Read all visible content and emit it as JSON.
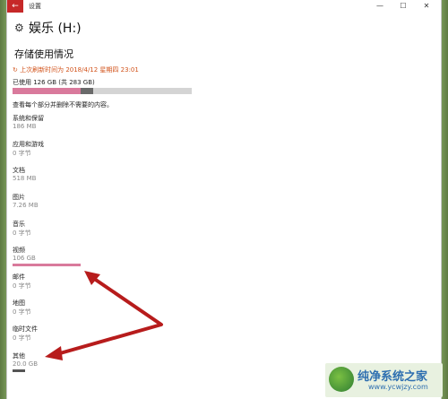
{
  "window": {
    "title": "设置",
    "back_icon": "←",
    "minimize": "—",
    "maximize": "☐",
    "close": "✕"
  },
  "page": {
    "icon": "gear-icon",
    "drive_title": "娱乐 (H:)",
    "section_heading": "存储使用情况",
    "refresh_text": "↻ 上次刷新时间为 2018/4/12 星期四 23:01",
    "used_text": "已使用 126 GB (共 283 GB)",
    "used_fraction": 0.445,
    "hint": "查看每个部分并删除不需要的内容。"
  },
  "items": [
    {
      "name": "系统和保留",
      "size": "186 MB"
    },
    {
      "name": "应用和游戏",
      "size": "0 字节"
    },
    {
      "name": "文档",
      "size": "518 MB"
    },
    {
      "name": "图片",
      "size": "7.26 MB"
    },
    {
      "name": "音乐",
      "size": "0 字节"
    },
    {
      "name": "视频",
      "size": "106 GB",
      "bar_fraction": 0.84
    },
    {
      "name": "邮件",
      "size": "0 字节"
    },
    {
      "name": "地图",
      "size": "0 字节"
    },
    {
      "name": "临时文件",
      "size": "0 字节"
    },
    {
      "name": "其他",
      "size": "20.0 GB",
      "bar_fraction": 0.16
    }
  ],
  "watermark": {
    "text": "纯净系统之家",
    "url": "www.ycwjzy.com"
  },
  "colors": {
    "accent_red": "#c62828",
    "refresh_orange": "#d2531b",
    "bar_pink": "#d97a9c",
    "bar_gray": "#6a6a6a",
    "arrow_red": "#b71c1c"
  }
}
